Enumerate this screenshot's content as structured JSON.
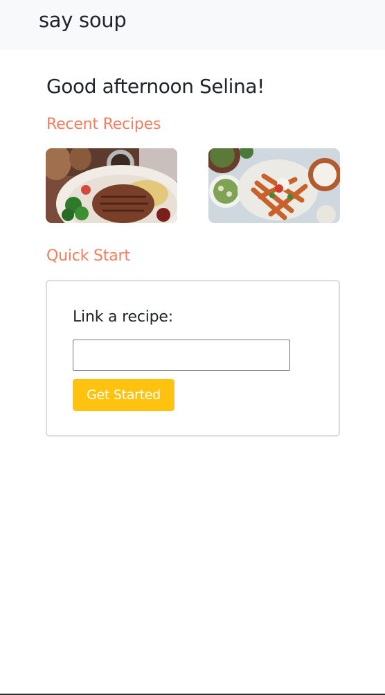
{
  "navbar": {
    "brand": "say soup"
  },
  "greeting": "Good afternoon Selina!",
  "recent_recipes": {
    "title": "Recent Recipes",
    "items": [
      {
        "image": "grilled-steak-plate-photo"
      },
      {
        "image": "loaded-fries-platter-photo"
      }
    ]
  },
  "quick_start": {
    "title": "Quick Start",
    "link_label": "Link a recipe:",
    "input_value": "",
    "input_placeholder": "",
    "button_label": "Get Started"
  },
  "colors": {
    "accent": "#f57d5e",
    "button": "#ffc20e",
    "navbar_bg": "#f8f9fa"
  }
}
